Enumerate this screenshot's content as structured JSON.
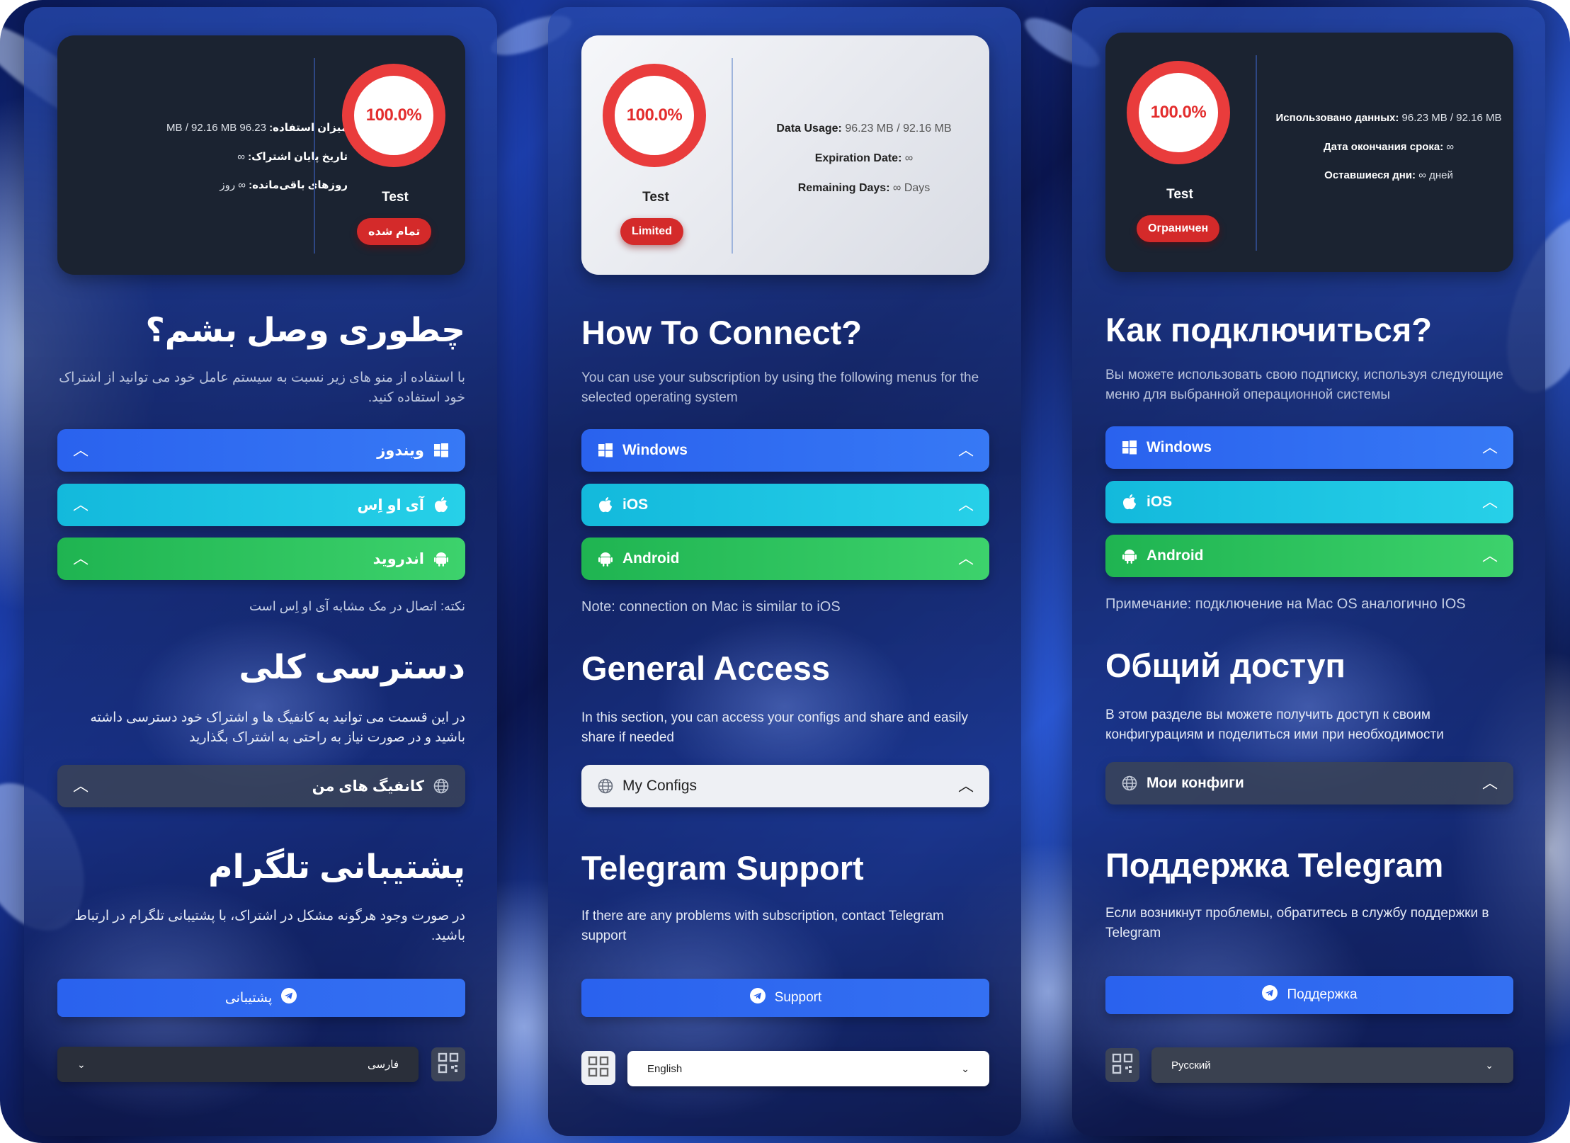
{
  "panels": {
    "fa": {
      "percent": "100.0%",
      "username": "Test",
      "status": "تمام شده",
      "usage_label": "میزان استفاده:",
      "usage_value": "96.23 MB / 92.16 MB",
      "expiry_label": "تاریخ پایان اشتراک:",
      "expiry_value": "∞",
      "remaining_label": "روزهای باقی‌مانده:",
      "remaining_value": "∞ روز",
      "connect_title": "چطوری وصل بشم؟",
      "connect_desc": "با استفاده از منو های زیر نسبت به سیستم عامل خود می توانید از اشتراک خود استفاده کنید.",
      "windows": "ویندوز",
      "ios": "آی او اِس",
      "android": "اندروید",
      "note": "نکته: اتصال در مک مشابه آی او اِس است",
      "access_title": "دسترسی کلی",
      "access_desc": "در این قسمت می توانید به کانفیگ ها و اشتراک خود دسترسی داشته باشید و در صورت نیاز به راحتی به اشتراک بگذارید",
      "configs": "کانفیگ های من",
      "support_title": "پشتیبانی تلگرام",
      "support_desc": "در صورت وجود هرگونه مشکل در اشتراک، با پشتیبانی تلگرام در ارتباط باشید.",
      "support_btn": "پشتیبانی",
      "language": "فارسی"
    },
    "en": {
      "percent": "100.0%",
      "username": "Test",
      "status": "Limited",
      "usage_label": "Data Usage:",
      "usage_value": "96.23 MB / 92.16 MB",
      "expiry_label": "Expiration Date:",
      "expiry_value": "∞",
      "remaining_label": "Remaining Days:",
      "remaining_value": "∞ Days",
      "connect_title": "How To Connect?",
      "connect_desc": "You can use your subscription by using the following menus for the selected operating system",
      "windows": "Windows",
      "ios": "iOS",
      "android": "Android",
      "note": "Note: connection on Mac is similar to iOS",
      "access_title": "General Access",
      "access_desc": "In this section, you can access your configs and share and easily share if needed",
      "configs": "My Configs",
      "support_title": "Telegram Support",
      "support_desc": "If there are any problems with subscription, contact Telegram support",
      "support_btn": "Support",
      "language": "English"
    },
    "ru": {
      "percent": "100.0%",
      "username": "Test",
      "status": "Ограничен",
      "usage_label": "Использовано данных:",
      "usage_value": "96.23 MB / 92.16 MB",
      "expiry_label": "Дата окончания срока:",
      "expiry_value": "∞",
      "remaining_label": "Оставшиеся дни:",
      "remaining_value": "∞ дней",
      "connect_title": "Как подключиться?",
      "connect_desc": "Вы можете использовать свою подписку, используя следующие меню для выбранной операционной системы",
      "windows": "Windows",
      "ios": "iOS",
      "android": "Android",
      "note": "Примечание: подключение на Mac OS аналогично IOS",
      "access_title": "Общий доступ",
      "access_desc": "В этом разделе вы можете получить доступ к своим конфигурациям и поделиться ими при необходимости",
      "configs": "Мои конфиги",
      "support_title": "Поддержка Telegram",
      "support_desc": "Если возникнут проблемы, обратитесь в службу поддержки в Telegram",
      "support_btn": "Поддержка",
      "language": "Русский"
    }
  },
  "usage_progress_percent": 100,
  "colors": {
    "ring": "#e93c3c",
    "badge": "#d42a2a",
    "windows": "#2a62ee",
    "ios": "#13b9dc",
    "android": "#1fb451",
    "support": "#2a62ee"
  },
  "icons": {
    "windows": "windows-icon",
    "ios": "apple-icon",
    "android": "android-icon",
    "configs": "globe-icon",
    "support": "telegram-icon",
    "qr": "qr-code-icon",
    "chevron": "chevron-up-icon"
  }
}
